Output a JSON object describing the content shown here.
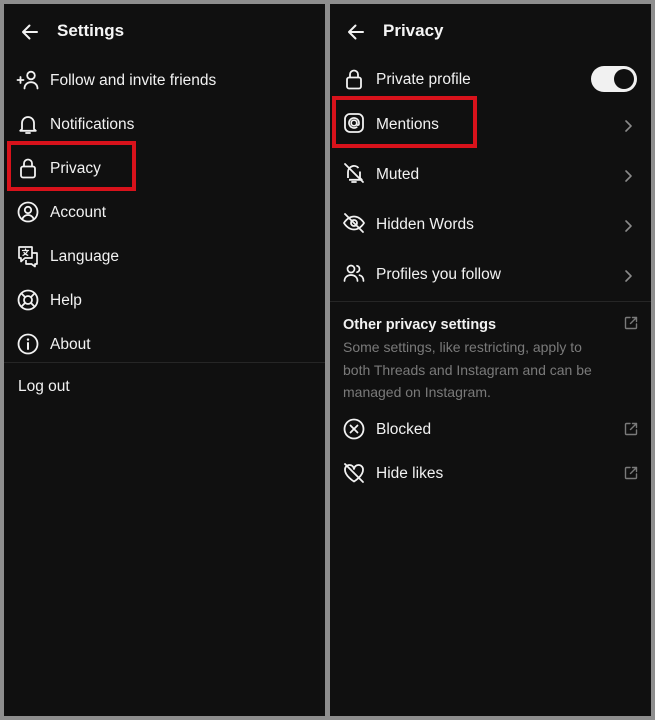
{
  "left": {
    "title": "Settings",
    "items": [
      {
        "label": "Follow and invite friends",
        "icon": "add-person-icon"
      },
      {
        "label": "Notifications",
        "icon": "bell-icon"
      },
      {
        "label": "Privacy",
        "icon": "lock-icon"
      },
      {
        "label": "Account",
        "icon": "account-circle-icon"
      },
      {
        "label": "Language",
        "icon": "translate-icon"
      },
      {
        "label": "Help",
        "icon": "lifebuoy-icon"
      },
      {
        "label": "About",
        "icon": "info-icon"
      }
    ],
    "logout": "Log out"
  },
  "right": {
    "title": "Privacy",
    "private_profile": {
      "label": "Private profile",
      "enabled": true
    },
    "items": [
      {
        "label": "Mentions",
        "icon": "at-sign-icon"
      },
      {
        "label": "Muted",
        "icon": "bell-muted-icon"
      },
      {
        "label": "Hidden Words",
        "icon": "eye-off-icon"
      },
      {
        "label": "Profiles you follow",
        "icon": "people-icon"
      }
    ],
    "other": {
      "title": "Other privacy settings",
      "description": "Some settings, like restricting, apply to both Threads and Instagram and can be managed on Instagram."
    },
    "external_items": [
      {
        "label": "Blocked",
        "icon": "blocked-icon"
      },
      {
        "label": "Hide likes",
        "icon": "heart-off-icon"
      }
    ]
  },
  "colors": {
    "background": "#101010",
    "highlight": "#d8121b",
    "text": "#f2f2f2",
    "muted_text": "#7a7a7a"
  }
}
